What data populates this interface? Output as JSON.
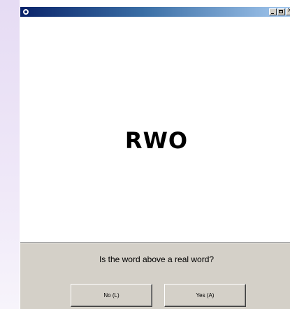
{
  "window": {
    "controls": {
      "minimize_icon": "minimize-icon",
      "maximize_icon": "maximize-icon",
      "close_icon": "close-icon"
    }
  },
  "stimulus": {
    "word": "RWO"
  },
  "prompt": {
    "question": "Is the word above a real word?"
  },
  "buttons": {
    "no_label": "No (L)",
    "yes_label": "Yes (A)"
  },
  "colors": {
    "titlebar_start": "#0a246a",
    "titlebar_end": "#a6caf0",
    "panel": "#d4d0c8",
    "stimulus_bg": "#ffffff",
    "desktop": "#e6dcf4"
  }
}
